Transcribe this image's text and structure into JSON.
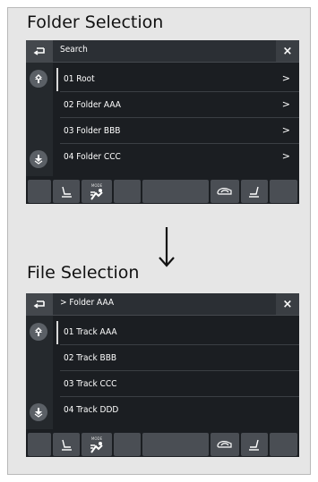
{
  "sections": [
    {
      "title": "Folder Selection",
      "screen": {
        "back_icon": "back-icon",
        "title": "Search",
        "close_label": "×",
        "rows": [
          {
            "label": "01 Root",
            "chevron": ">"
          },
          {
            "label": "02 Folder AAA",
            "chevron": ">"
          },
          {
            "label": "03 Folder BBB",
            "chevron": ">"
          },
          {
            "label": "04 Folder CCC",
            "chevron": ">"
          }
        ],
        "mode_label": "MODE"
      }
    },
    {
      "title": "File Selection",
      "screen": {
        "back_icon": "back-icon",
        "title": "> Folder AAA",
        "close_label": "×",
        "rows": [
          {
            "label": "01 Track AAA",
            "chevron": ""
          },
          {
            "label": "02 Track BBB",
            "chevron": ""
          },
          {
            "label": "03 Track CCC",
            "chevron": ""
          },
          {
            "label": "04 Track DDD",
            "chevron": ""
          }
        ],
        "mode_label": "MODE"
      }
    }
  ],
  "colors": {
    "screen_bg": "#1b1e22",
    "button_bg": "#4a4e54",
    "text": "#ffffff"
  }
}
